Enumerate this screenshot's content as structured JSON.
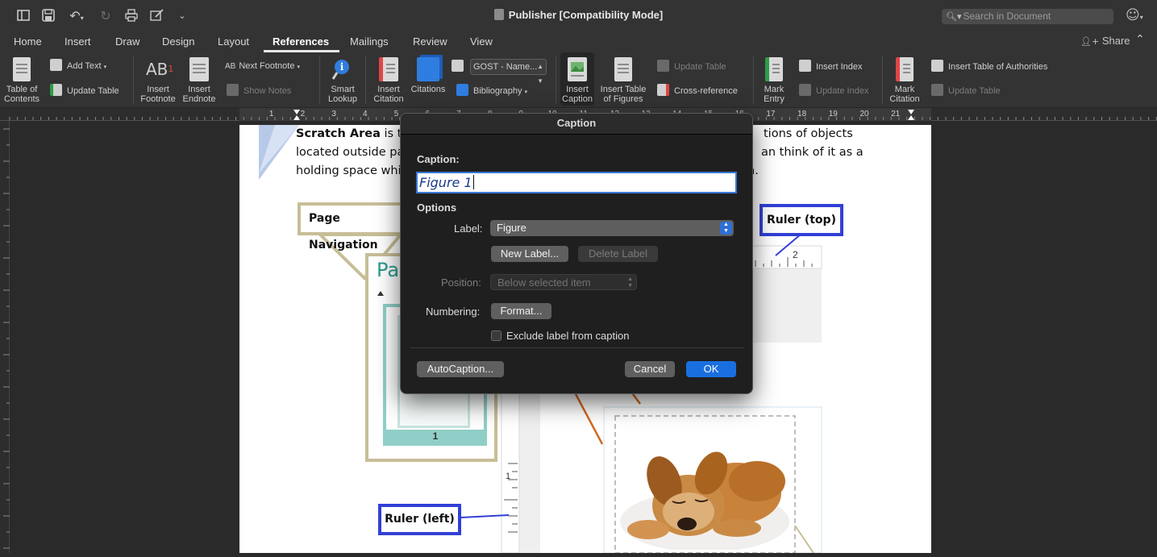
{
  "titlebar": {
    "title": "Publisher [Compatibility Mode]",
    "search_placeholder": "Search in Document",
    "icons": [
      "sidebar-icon",
      "save-icon",
      "undo-icon",
      "redo-icon",
      "print-icon",
      "edit-icon",
      "customize-icon",
      "search-icon",
      "smiley-icon"
    ]
  },
  "tabs": {
    "items": [
      "Home",
      "Insert",
      "Draw",
      "Design",
      "Layout",
      "References",
      "Mailings",
      "Review",
      "View"
    ],
    "active": "References",
    "share_label": "Share"
  },
  "ribbon": {
    "toc": "Table of\nContents",
    "add_text": "Add Text",
    "update_table_1": "Update Table",
    "insert_footnote": "Insert\nFootnote",
    "insert_endnote": "Insert\nEndnote",
    "next_footnote": "Next Footnote",
    "show_notes": "Show Notes",
    "smart_lookup": "Smart\nLookup",
    "insert_citation": "Insert\nCitation",
    "citations": "Citations",
    "style_value": "GOST - Name...",
    "bibliography": "Bibliography",
    "insert_caption": "Insert\nCaption",
    "insert_table_of_figures": "Insert Table\nof Figures",
    "update_table_2": "Update Table",
    "cross_reference": "Cross-reference",
    "mark_entry": "Mark\nEntry",
    "insert_index": "Insert Index",
    "update_index": "Update Index",
    "mark_citation": "Mark\nCitation",
    "insert_table_of_authorities": "Insert Table of Authorities",
    "update_table_3": "Update Table"
  },
  "ruler": {
    "numbers": [
      "1",
      "2",
      "3",
      "4",
      "5",
      "6",
      "7",
      "8",
      "9",
      "10",
      "11",
      "12",
      "13",
      "14",
      "15",
      "16",
      "17",
      "18",
      "19",
      "20",
      "21"
    ]
  },
  "document": {
    "line1_bold": "Scratch Area",
    "line1_a": " is th",
    "line1_b": "tions of objects",
    "line2_a": "located outside pa",
    "line2_b": "an think of it as a",
    "line3_a": "holding space while",
    "line3_b": "n.",
    "callout_page_nav": "Page Navigation",
    "callout_ruler_top": "Ruler (top)",
    "callout_ruler_left": "Ruler (left)",
    "thumb_title": "Pa",
    "thumb_page_number": "1",
    "inner_ruler_top_num": "2",
    "inner_ruler_left_num": "1"
  },
  "dialog": {
    "title": "Caption",
    "caption_label": "Caption:",
    "caption_value": "Figure 1",
    "options_label": "Options",
    "label_label": "Label:",
    "label_value": "Figure",
    "new_label_button": "New Label...",
    "delete_label_button": "Delete Label",
    "position_label": "Position:",
    "position_value": "Below selected item",
    "numbering_label": "Numbering:",
    "format_button": "Format...",
    "exclude_label": "Exclude label from caption",
    "autocaption_button": "AutoCaption...",
    "cancel_button": "Cancel",
    "ok_button": "OK"
  },
  "colors": {
    "accent": "#1a6fe0",
    "callout_gold": "#c7be97",
    "callout_blue": "#3140d6",
    "arrow_orange": "#d2691e"
  }
}
